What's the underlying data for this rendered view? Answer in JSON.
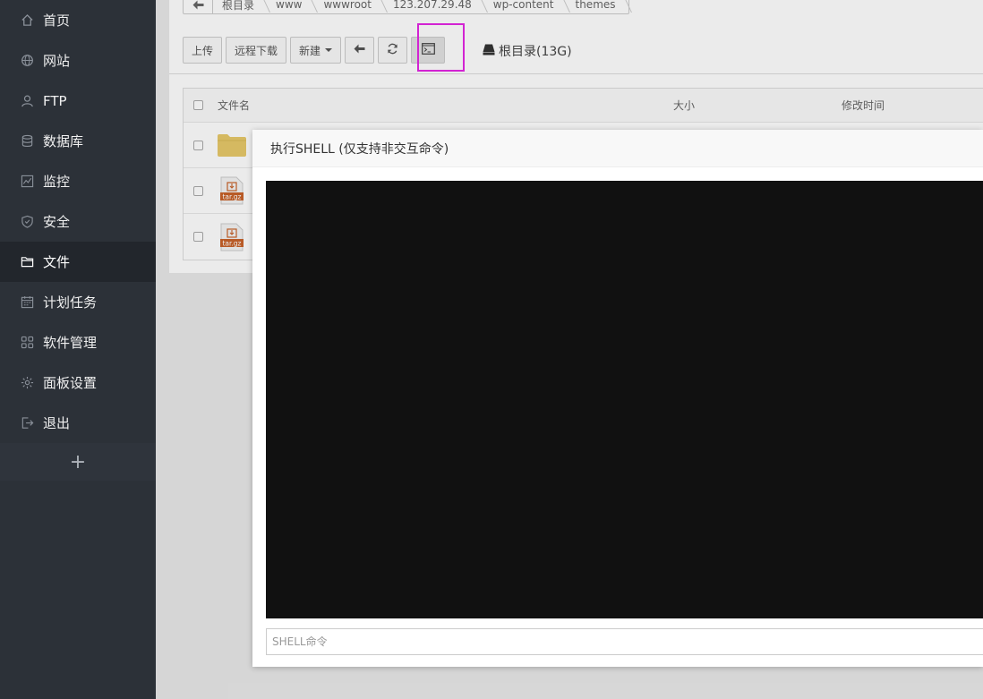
{
  "sidebar": {
    "items": [
      {
        "label": "首页",
        "icon": "home-icon"
      },
      {
        "label": "网站",
        "icon": "globe-icon"
      },
      {
        "label": "FTP",
        "icon": "user-icon"
      },
      {
        "label": "数据库",
        "icon": "database-icon"
      },
      {
        "label": "监控",
        "icon": "monitor-icon"
      },
      {
        "label": "安全",
        "icon": "shield-icon"
      },
      {
        "label": "文件",
        "icon": "folder-icon",
        "active": true
      },
      {
        "label": "计划任务",
        "icon": "calendar-icon"
      },
      {
        "label": "软件管理",
        "icon": "apps-icon"
      },
      {
        "label": "面板设置",
        "icon": "gear-icon"
      },
      {
        "label": "退出",
        "icon": "logout-icon"
      }
    ],
    "add_label": "+"
  },
  "breadcrumb": [
    "根目录",
    "www",
    "wwwroot",
    "123.207.29.48",
    "wp-content",
    "themes"
  ],
  "toolbar": {
    "upload": "上传",
    "remote_download": "远程下载",
    "new": "新建",
    "disk_label": "根目录(13G)"
  },
  "table": {
    "headers": {
      "name": "文件名",
      "size": "大小",
      "time": "修改时间"
    },
    "file_badge": "tar.gz"
  },
  "dialog": {
    "title": "执行SHELL (仅支持非交互命令)",
    "input_placeholder": "SHELL命令"
  },
  "colors": {
    "sidebar_bg": "#2c3138",
    "highlight": "#e426e4",
    "terminal_bg": "#111111",
    "folder": "#e8c96a"
  }
}
